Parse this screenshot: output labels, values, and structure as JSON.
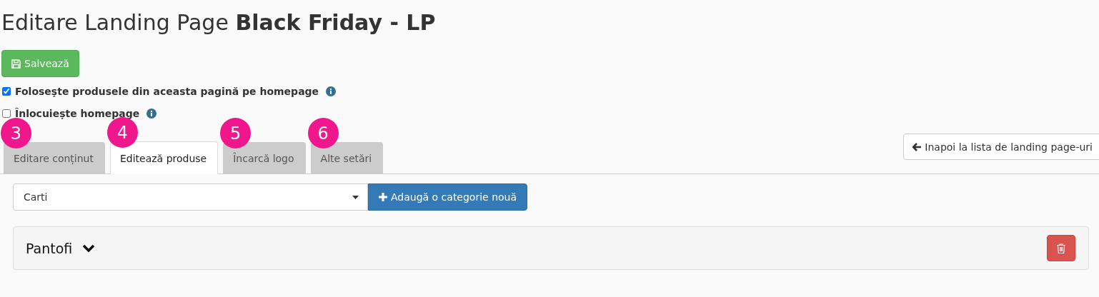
{
  "title": {
    "prefix": "Editare Landing Page",
    "name": "Black Friday - LP"
  },
  "save_button": {
    "label": "Salvează"
  },
  "options": [
    {
      "label": "Folosește produsele din aceasta pagină pe homepage",
      "checked": true
    },
    {
      "label": "Înlocuiește homepage",
      "checked": false
    }
  ],
  "tabs": [
    {
      "label": "Editare conținut",
      "badge": "3",
      "selected": false
    },
    {
      "label": "Editează produse",
      "badge": "4",
      "selected": true
    },
    {
      "label": "Încarcă logo",
      "badge": "5",
      "selected": false
    },
    {
      "label": "Alte setări",
      "badge": "6",
      "selected": false
    }
  ],
  "back_button": {
    "label": "Inapoi la lista de landing page-uri"
  },
  "category_select": {
    "value": "Carti"
  },
  "add_button": {
    "label": "Adaugă o categorie nouă"
  },
  "panels": [
    {
      "title": "Pantofi",
      "expanded": false
    }
  ]
}
